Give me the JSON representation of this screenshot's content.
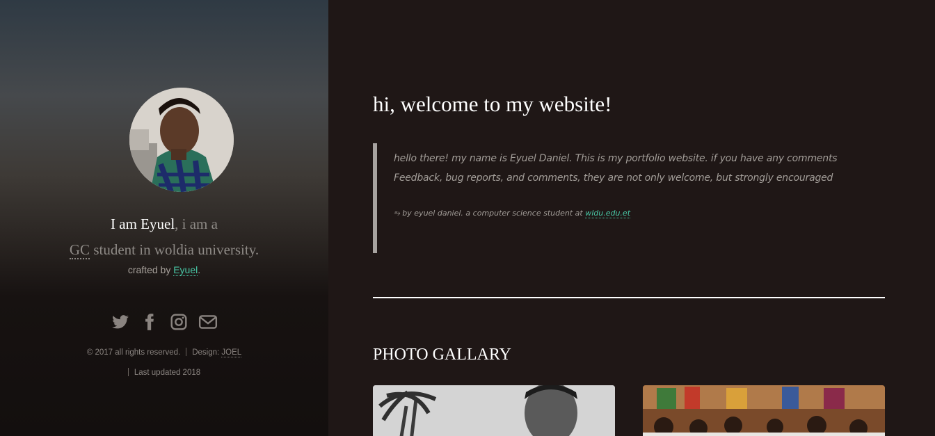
{
  "sidebar": {
    "intro_name": "I am Eyuel",
    "intro_rest1": ", i am a",
    "intro_abbr": "GC",
    "intro_rest2": " student in woldia university.",
    "crafted_prefix": "crafted by ",
    "crafted_link": "Eyuel",
    "crafted_suffix": ".",
    "socials": [
      "twitter-icon",
      "facebook-icon",
      "instagram-icon",
      "envelope-icon"
    ],
    "copyright": "© 2017 all rights reserved.",
    "design_label": "Design: ",
    "design_link": "JOEL",
    "last_updated": "Last updated 2018"
  },
  "main": {
    "welcome": "hi, welcome to my website!",
    "quote_text": "hello there! my name is Eyuel Daniel. This is my portfolio website. if you have any comments Feedback, bug reports, and comments, they are not only welcome, but strongly encouraged",
    "cite_prefix": "⥱ by eyuel daniel. a computer science student at ",
    "cite_link": "wldu.edu.et",
    "gallery_title": "PHOTO GALLARY"
  },
  "colors": {
    "accent": "#49c8a6",
    "background": "#1f1716",
    "text_muted": "#8e8a86"
  }
}
